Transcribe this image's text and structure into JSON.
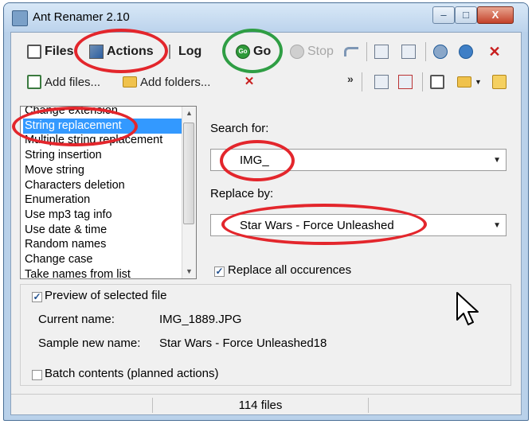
{
  "window": {
    "title": "Ant Renamer 2.10",
    "controls": {
      "minimize": "‒",
      "maximize": "□",
      "close": "X"
    }
  },
  "toolbar": {
    "files": "Files",
    "actions": "Actions",
    "log": "Log",
    "go": "Go",
    "go_icon_text": "Go",
    "stop": "Stop",
    "add_files": "Add files...",
    "add_folders": "Add folders...",
    "chevron": "»"
  },
  "actions_list": {
    "items": [
      "Change extension",
      "String replacement",
      "Multiple string replacement",
      "String insertion",
      "Move string",
      "Characters deletion",
      "Enumeration",
      "Use mp3 tag info",
      "Use date & time",
      "Random names",
      "Change case",
      "Take names from list"
    ],
    "selected_index": 1
  },
  "form": {
    "search_label": "Search for:",
    "search_value": "IMG_",
    "replace_label": "Replace by:",
    "replace_value": "Star Wars - Force Unleashed",
    "replace_all_label": "Replace all occurences",
    "replace_all_checked": true
  },
  "preview": {
    "checkbox_label": "Preview of selected file",
    "checked": true,
    "current_name_label": "Current name:",
    "current_name_value": "IMG_1889.JPG",
    "sample_new_name_label": "Sample new name:",
    "sample_new_name_value": "Star Wars - Force Unleashed18"
  },
  "batch": {
    "label": "Batch contents (planned actions)",
    "checked": false
  },
  "status": {
    "files_count": "114 files"
  },
  "colors": {
    "annotation_red": "#e3262c",
    "annotation_green": "#2f9e44",
    "selection": "#3399ff"
  }
}
